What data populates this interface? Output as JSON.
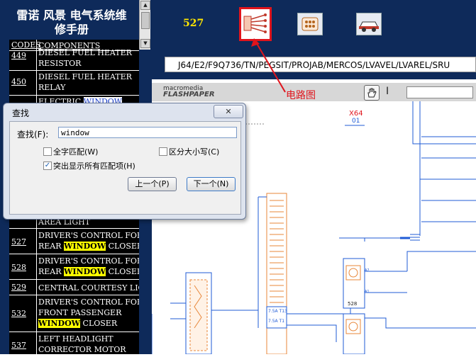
{
  "left_panel": {
    "title_line1": "雷诺 风景 电气系统维",
    "title_line2": "修手册",
    "header_codes": "CODES",
    "header_components": "COMPONENTS",
    "rows": [
      {
        "code": "449",
        "line1": "DIESEL FUEL HEATER",
        "line2": "RESISTOR"
      },
      {
        "code": "450",
        "line1": "DIESEL FUEL HEATER",
        "line2": "RELAY"
      },
      {
        "code": "",
        "line1": "ELECTRIC ",
        "line1_hl": "WINDOW",
        "line2": ""
      },
      {
        "code": "",
        "line1": "AREA LIGHT",
        "line2": ""
      },
      {
        "code": "527",
        "line1": "DRIVER'S CONTROL FOR",
        "line2_pre": "REAR ",
        "line2_hl": "WINDOW",
        "line2_post": " CLOSER"
      },
      {
        "code": "528",
        "line1": "DRIVER'S CONTROL FOR",
        "line2_pre": "REAR ",
        "line2_hl": "WINDOW",
        "line2_post": " CLOSER"
      },
      {
        "code": "529",
        "line1": "CENTRAL COURTESY LIG",
        "line2": ""
      },
      {
        "code": "532",
        "line1": "DRIVER'S CONTROL FOR",
        "line2": "FRONT PASSENGER",
        "line3_hl": "WINDOW",
        "line3_post": " CLOSER"
      },
      {
        "code": "537",
        "line1": "LEFT HEADLIGHT",
        "line2": "CORRECTOR MOTOR"
      }
    ]
  },
  "header": {
    "number": "527",
    "path": "J64/E2/F9Q736/TN/PEGSIT/PROJAB/MERCOS/LVAVEL/LVAREL/SRU"
  },
  "toolbar_icons": [
    "circuit-diagram-icon",
    "connector-icon",
    "vehicle-icon"
  ],
  "flashpaper": {
    "brand_small": "macromedia",
    "brand": "FLASHPAPER"
  },
  "annotation": {
    "label": "电路图"
  },
  "diagram": {
    "connector_id": "X64",
    "connector_sub": "01",
    "box_labels": [
      "528",
      "528"
    ],
    "fuse_labels": [
      "7.5A  T13",
      "7.5A  T1"
    ]
  },
  "find_dialog": {
    "title": "查找",
    "close_label": "✕",
    "find_label": "查找(F):",
    "find_value": "window",
    "opt_whole_word": "全字匹配(W)",
    "opt_match_case": "区分大小写(C)",
    "opt_highlight_all": "突出显示所有匹配项(H)",
    "btn_prev": "上一个(P)",
    "btn_next": "下一个(N)",
    "whole_word_checked": false,
    "match_case_checked": false,
    "highlight_all_checked": true
  },
  "colors": {
    "panel_bg": "#0e2a5a",
    "highlight": "#ffff00",
    "annotation_red": "#e0141c",
    "wire_blue": "#1f5bd6",
    "wire_orange": "#e8873a"
  }
}
